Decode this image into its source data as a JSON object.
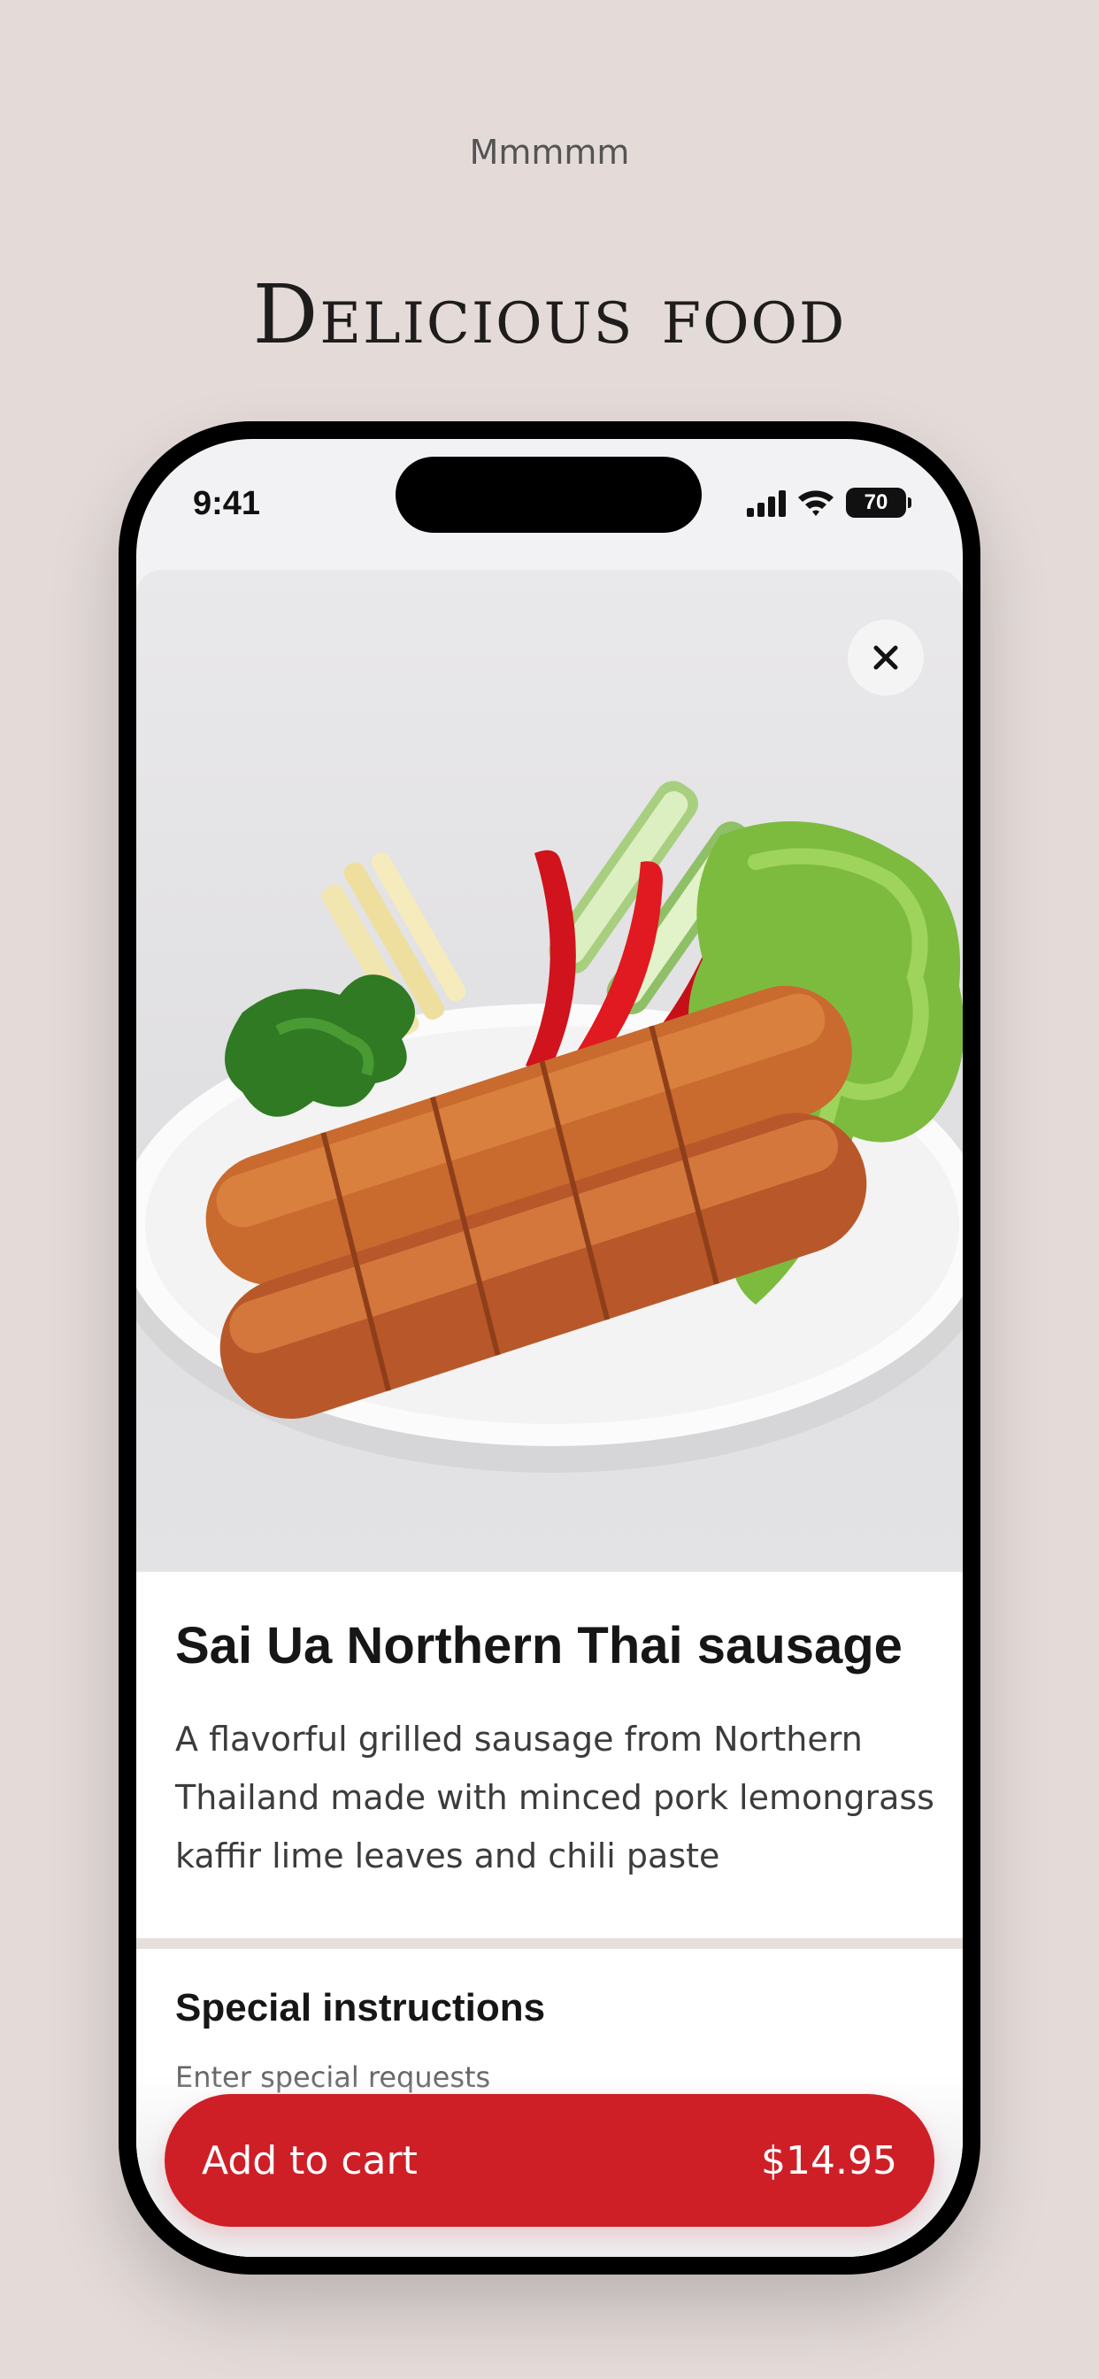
{
  "header": {
    "eyebrow": "Mmmmm",
    "headline": "Delicious food"
  },
  "status_bar": {
    "time": "9:41",
    "battery": "70",
    "icons": [
      "cellular-signal-icon",
      "wifi-icon",
      "battery-icon"
    ]
  },
  "product": {
    "image_description": "grilled-sausage-plate-image",
    "close_icon": "close-icon",
    "title": "Sai Ua Northern Thai sausage",
    "description": "A flavorful grilled sausage from Northern Thailand made with minced pork lemongrass kaffir lime leaves and chili paste"
  },
  "special_instructions": {
    "title": "Special instructions",
    "placeholder": "Enter special requests"
  },
  "cart": {
    "label": "Add to cart",
    "price": "$14.95",
    "accent_color": "#ce1f27"
  }
}
